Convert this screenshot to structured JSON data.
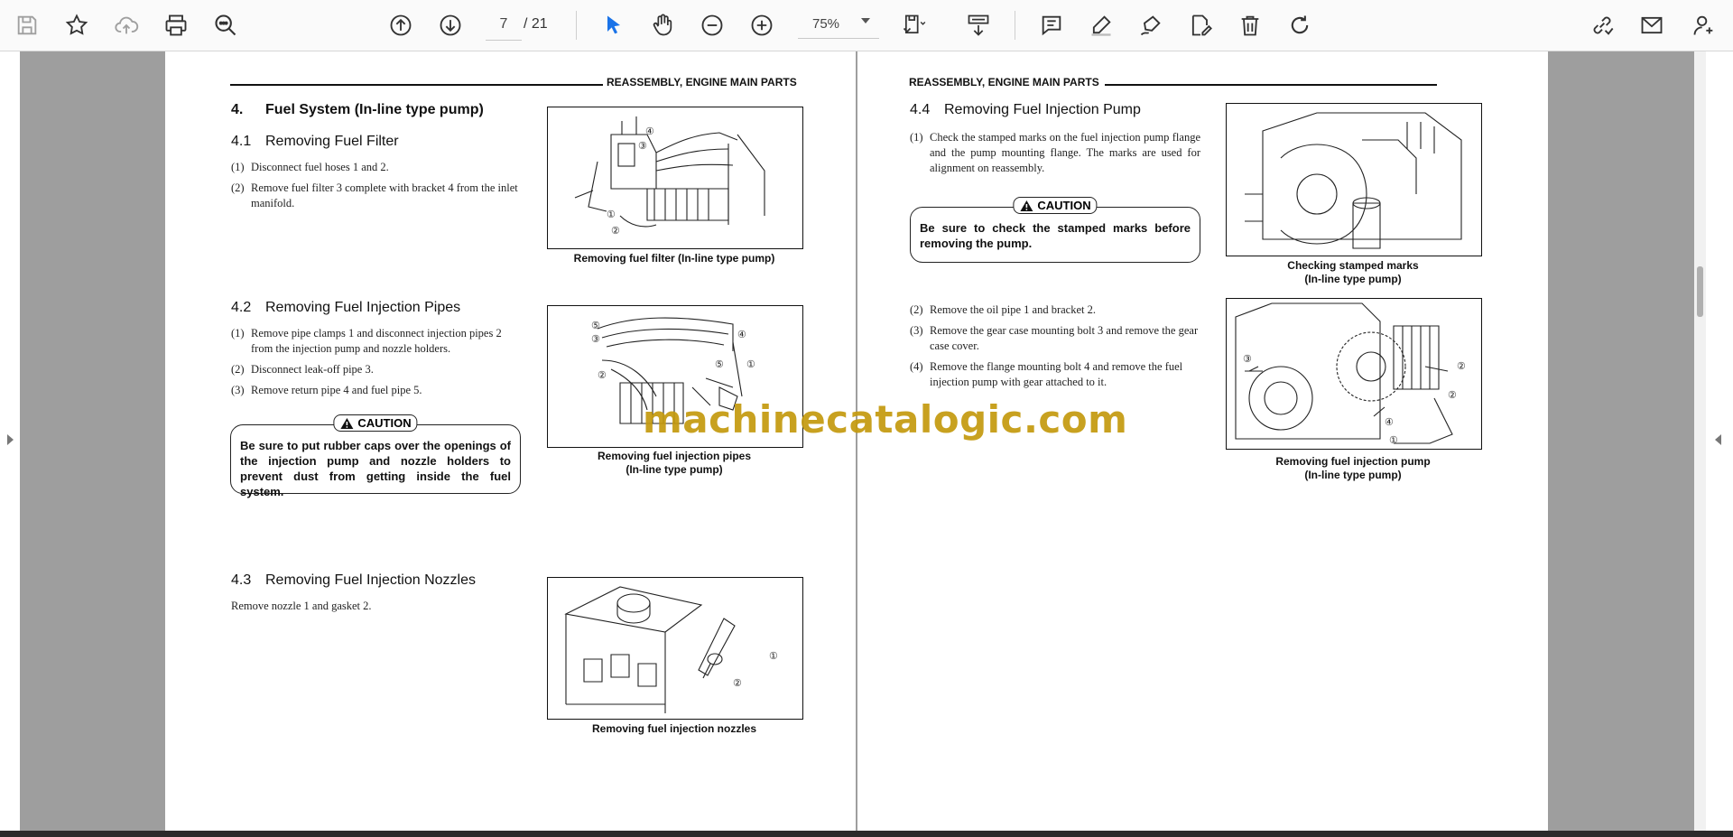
{
  "toolbar": {
    "page_current": "7",
    "page_total": "/ 21",
    "zoom": "75%",
    "icons": [
      "save-icon",
      "bookmark-star-icon",
      "cloud-upload-icon",
      "print-icon",
      "find-text-icon",
      "prev-page-icon",
      "next-page-icon",
      "select-cursor-icon",
      "hand-tool-icon",
      "zoom-out-icon",
      "zoom-in-icon",
      "page-fit-icon",
      "scroll-mode-icon",
      "comment-icon",
      "highlight-pen-icon",
      "sign-icon",
      "edit-pdf-icon",
      "delete-icon",
      "rotate-icon",
      "share-link-icon",
      "email-icon",
      "add-user-icon"
    ]
  },
  "left_page": {
    "header": "REASSEMBLY, ENGINE MAIN PARTS",
    "section4": {
      "num": "4.",
      "title": "Fuel System (In-line type pump)"
    },
    "s41": {
      "num": "4.1",
      "title": "Removing Fuel Filter",
      "steps": [
        {
          "n": "(1)",
          "t": "Disconnect fuel hoses 1 and 2."
        },
        {
          "n": "(2)",
          "t": "Remove fuel filter 3 complete with bracket 4 from the inlet manifold."
        }
      ],
      "figure_caption": "Removing fuel filter (In-line type pump)"
    },
    "s42": {
      "num": "4.2",
      "title": "Removing Fuel Injection Pipes",
      "steps": [
        {
          "n": "(1)",
          "t": "Remove pipe clamps 1 and disconnect injection pipes 2 from the injection pump and nozzle holders."
        },
        {
          "n": "(2)",
          "t": "Disconnect leak-off pipe 3."
        },
        {
          "n": "(3)",
          "t": "Remove return pipe 4 and fuel pipe 5."
        }
      ],
      "caution_label": "CAUTION",
      "caution_text": "Be sure to put rubber caps over the openings of the injection pump and nozzle holders to prevent dust from getting inside the fuel system.",
      "figure_caption_1": "Removing fuel injection pipes",
      "figure_caption_2": "(In-line type pump)"
    },
    "s43": {
      "num": "4.3",
      "title": "Removing Fuel Injection Nozzles",
      "text": "Remove nozzle 1 and gasket 2.",
      "figure_caption": "Removing fuel injection nozzles"
    }
  },
  "right_page": {
    "header": "REASSEMBLY, ENGINE MAIN PARTS",
    "s44": {
      "num": "4.4",
      "title": "Removing Fuel Injection Pump",
      "steps_a": [
        {
          "n": "(1)",
          "t": "Check the stamped marks on the fuel injection pump flange and the pump mounting flange. The marks are used for alignment on reassembly."
        }
      ],
      "caution_label": "CAUTION",
      "caution_text": "Be sure to check the stamped marks before removing the pump.",
      "steps_b": [
        {
          "n": "(2)",
          "t": "Remove the oil pipe 1 and bracket 2."
        },
        {
          "n": "(3)",
          "t": "Remove the gear case mounting bolt 3 and remove the gear case cover."
        },
        {
          "n": "(4)",
          "t": "Remove the flange mounting bolt 4 and remove the fuel injection pump with gear attached to it."
        }
      ],
      "figure1_caption_1": "Checking stamped marks",
      "figure1_caption_2": "(In-line type pump)",
      "figure2_caption_1": "Removing fuel injection pump",
      "figure2_caption_2": "(In-line type pump)"
    }
  },
  "watermark": "machinecatalogic.com",
  "callouts": [
    "①",
    "②",
    "③",
    "④",
    "⑤"
  ]
}
